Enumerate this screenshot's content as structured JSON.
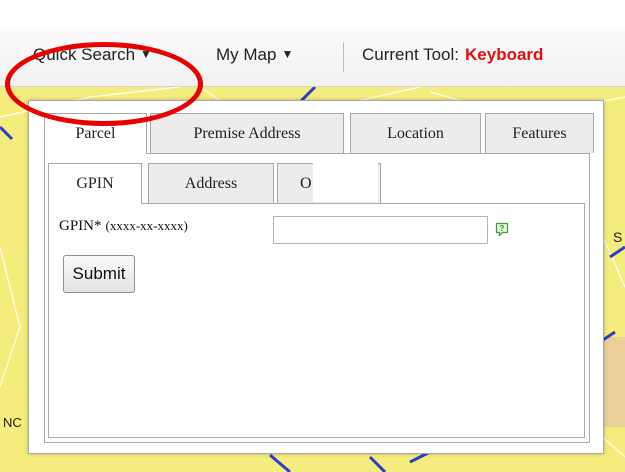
{
  "toolbar": {
    "quick_search": "Quick Search",
    "my_map": "My Map",
    "current_tool_label": "Current Tool:",
    "current_tool_value": "Keyboard"
  },
  "panel": {
    "outer_tabs": [
      "Parcel",
      "Premise Address",
      "Location",
      "Features"
    ],
    "inner_tabs": [
      "GPIN",
      "Address",
      "O"
    ],
    "gpin_label": "GPIN*",
    "gpin_format": "(xxxx-xx-xxxx)",
    "gpin_value": "",
    "submit_label": "Submit"
  },
  "map": {
    "visible_text": [
      "S",
      "NC"
    ]
  },
  "colors": {
    "current_tool": "#e01010",
    "highlight": "#e60000",
    "map_land": "#f5ec7e",
    "roads": "#2b3fc7"
  },
  "icons": {
    "dropdown": "caret-down-icon",
    "help": "help-bubble-icon"
  }
}
